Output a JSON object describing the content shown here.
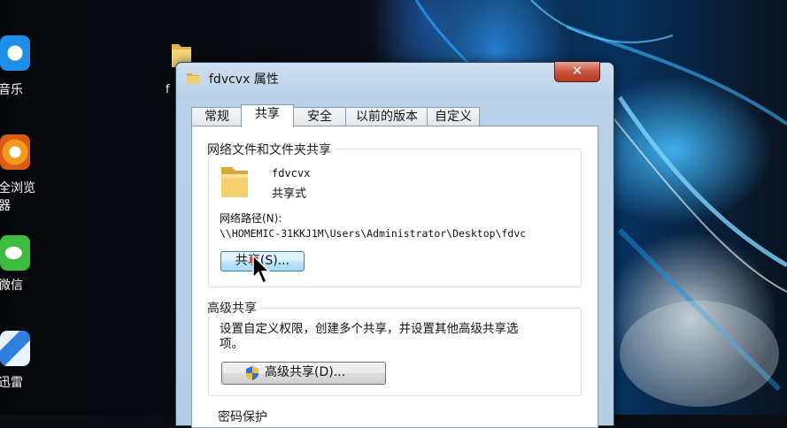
{
  "desktop": {
    "icons": [
      {
        "label": "音乐",
        "icon": "kugou-music-icon",
        "color": "#1e8fe8"
      },
      {
        "label": "全浏览",
        "label2": "器",
        "icon": "browser-icon",
        "color": "#f29a1c"
      },
      {
        "label": "微信",
        "icon": "wechat-icon",
        "color": "#3dbb3d"
      },
      {
        "label": "迅雷",
        "icon": "thunder-icon",
        "color": "#2d7fe0"
      }
    ],
    "folder_label": "f"
  },
  "dialog": {
    "title": "fdvcvx 属性",
    "close_symbol": "✕",
    "tabs": [
      {
        "label": "常规",
        "active": false
      },
      {
        "label": "共享",
        "active": true
      },
      {
        "label": "安全",
        "active": false
      },
      {
        "label": "以前的版本",
        "active": false
      },
      {
        "label": "自定义",
        "active": false
      }
    ],
    "network_group": {
      "title": "网络文件和文件夹共享",
      "folder_name": "fdvcvx",
      "share_status": "共享式",
      "path_label": "网络路径(N):",
      "path_value": "\\\\HOMEMIC-31KKJ1M\\Users\\Administrator\\Desktop\\fdvc",
      "share_button": "共享(S)..."
    },
    "advanced_group": {
      "title": "高级共享",
      "description_line1": "设置自定义权限，创建多个共享，并设置其他高级共享选",
      "description_line2": "项。",
      "button": "高级共享(D)..."
    },
    "password_group": {
      "title": "密码保护"
    }
  },
  "colors": {
    "close_button": "#c8553f",
    "selected_button": "#bee6fd"
  }
}
